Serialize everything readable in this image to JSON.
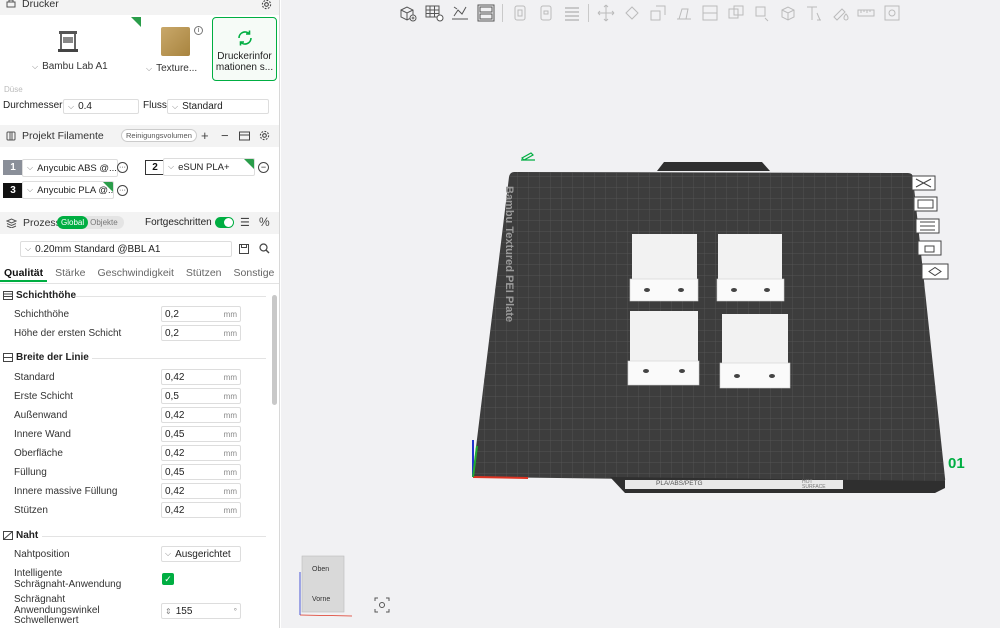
{
  "printer_section": {
    "title": "Drucker",
    "printer_name": "Bambu Lab A1",
    "plate_label": "Texture...",
    "sync_label": "Druckerinformationen s...",
    "sync_label_line1": "Druckerinfor",
    "sync_label_line2": "mationen s...",
    "nozzle_hint": "Düse",
    "diameter_label": "Durchmesser",
    "diameter_value": "0.4",
    "flow_label": "Fluss",
    "flow_value": "Standard"
  },
  "filament_section": {
    "title": "Projekt Filamente",
    "cleaning_button": "Reinigungsvolumen",
    "items": [
      {
        "index": "1",
        "name": "Anycubic ABS @...",
        "color": "#8a8f99"
      },
      {
        "index": "2",
        "name": "eSUN PLA+",
        "color": "#ffffff"
      },
      {
        "index": "3",
        "name": "Anycubic PLA @...",
        "color": "#111111"
      }
    ]
  },
  "process_section": {
    "title": "Prozess",
    "toggle_global": "Global",
    "toggle_objects": "Objekte",
    "advanced_label": "Fortgeschritten",
    "profile": "0.20mm Standard @BBL A1",
    "tabs": [
      "Qualität",
      "Stärke",
      "Geschwindigkeit",
      "Stützen",
      "Sonstige"
    ],
    "groups": {
      "layer_height": {
        "title": "Schichthöhe",
        "params": [
          {
            "label": "Schichthöhe",
            "value": "0,2",
            "unit": "mm"
          },
          {
            "label": "Höhe der ersten Schicht",
            "value": "0,2",
            "unit": "mm"
          }
        ]
      },
      "line_width": {
        "title": "Breite der Linie",
        "params": [
          {
            "label": "Standard",
            "value": "0,42",
            "unit": "mm"
          },
          {
            "label": "Erste Schicht",
            "value": "0,5",
            "unit": "mm"
          },
          {
            "label": "Außenwand",
            "value": "0,42",
            "unit": "mm"
          },
          {
            "label": "Innere Wand",
            "value": "0,45",
            "unit": "mm"
          },
          {
            "label": "Oberfläche",
            "value": "0,42",
            "unit": "mm"
          },
          {
            "label": "Füllung",
            "value": "0,45",
            "unit": "mm"
          },
          {
            "label": "Innere massive Füllung",
            "value": "0,42",
            "unit": "mm"
          },
          {
            "label": "Stützen",
            "value": "0,42",
            "unit": "mm"
          }
        ]
      },
      "seam": {
        "title": "Naht",
        "position_label": "Nahtposition",
        "position_value": "Ausgerichtet",
        "smart_label_1": "Intelligente",
        "smart_label_2": "Schrägnaht-Anwendung",
        "angle_label_1": "Schrägnaht",
        "angle_label_2": "Anwendungswinkel",
        "angle_label_3": "Schwellenwert",
        "angle_value": "155",
        "angle_unit": "°"
      }
    }
  },
  "viewport": {
    "plate_brand_text": "Bambu Textured PEI Plate",
    "plate_number": "01",
    "plate_footer_text": "PLA/ABS/PETG",
    "plate_footer_text2": "HOT SURFACE",
    "view_cube_top": "Oben",
    "view_cube_front": "Vorne",
    "accent_color": "#00ae42",
    "bed_color": "#3d3d3d"
  }
}
